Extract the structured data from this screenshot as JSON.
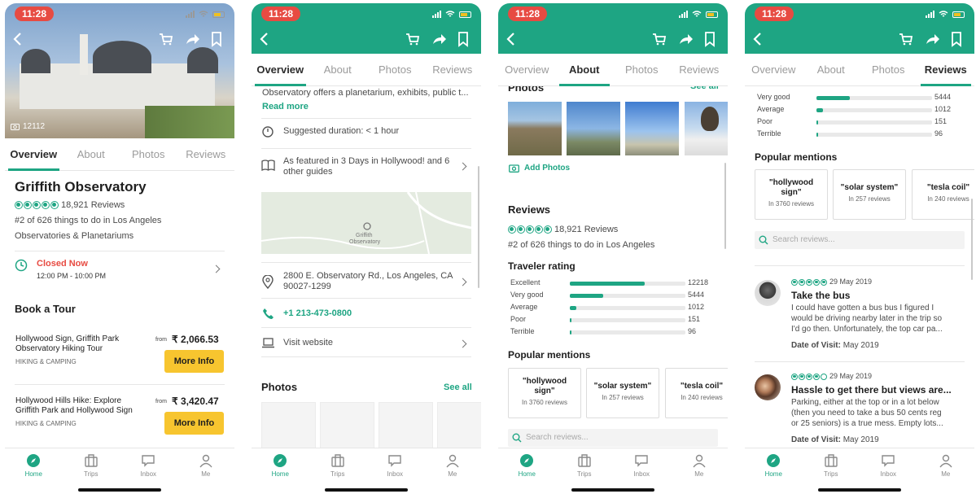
{
  "status": {
    "time": "11:28"
  },
  "tabs": [
    "Overview",
    "About",
    "Photos",
    "Reviews"
  ],
  "nav": [
    "Home",
    "Trips",
    "Inbox",
    "Me"
  ],
  "colors": {
    "accent": "#1ea583",
    "closed": "#e74b42",
    "button": "#f7c52f"
  },
  "s1": {
    "photo_count": "12112",
    "title": "Griffith Observatory",
    "reviews": "18,921 Reviews",
    "rank": "#2 of 626 things to do in Los Angeles",
    "category": "Observatories & Planetariums",
    "closed": "Closed Now",
    "hours": "12:00 PM - 10:00 PM",
    "book_title": "Book a Tour",
    "tours": [
      {
        "name1": "Hollywood Sign, Griffith Park",
        "name2": "Observatory Hiking Tour",
        "cat": "HIKING & CAMPING",
        "from": "from",
        "price": "₹ 2,066.53",
        "btn": "More Info"
      },
      {
        "name1": "Hollywood Hills Hike: Explore",
        "name2": "Griffith Park and Hollywood Sign",
        "cat": "HIKING & CAMPING",
        "from": "from",
        "price": "₹ 3,420.47",
        "btn": "More Info"
      }
    ]
  },
  "s2": {
    "desc": "Observatory offers a planetarium, exhibits, public t...",
    "read_more": "Read more",
    "duration": "Suggested duration: < 1 hour",
    "featured1": "As featured in 3 Days in Hollywood! and 6",
    "featured2": "other guides",
    "map_label1": "Griffith",
    "map_label2": "Observatory",
    "address1": "2800 E. Observatory Rd., Los Angeles, CA",
    "address2": "90027-1299",
    "phone": "+1 213-473-0800",
    "website": "Visit website",
    "photos_title": "Photos",
    "see_all": "See all"
  },
  "s3": {
    "photos_title": "Photos",
    "see_all": "See all",
    "add_photos": "Add Photos",
    "reviews_title": "Reviews",
    "reviews": "18,921 Reviews",
    "rank": "#2 of 626 things to do in Los Angeles",
    "traveler_rating": "Traveler rating",
    "ratings": [
      {
        "label": "Excellent",
        "count": "12218",
        "fraction": 0.65
      },
      {
        "label": "Very good",
        "count": "5444",
        "fraction": 0.29
      },
      {
        "label": "Average",
        "count": "1012",
        "fraction": 0.054
      },
      {
        "label": "Poor",
        "count": "151",
        "fraction": 0.012
      },
      {
        "label": "Terrible",
        "count": "96",
        "fraction": 0.008
      }
    ],
    "popular_mentions": "Popular mentions",
    "mentions": [
      {
        "q1": "\"hollywood",
        "q2": "sign\"",
        "n": "In 3760 reviews"
      },
      {
        "q1": "\"solar system\"",
        "q2": "",
        "n": "In 257 reviews"
      },
      {
        "q1": "\"tesla coil\"",
        "q2": "",
        "n": "In 240 reviews"
      }
    ],
    "search_placeholder": "Search reviews..."
  },
  "s4": {
    "ratings": [
      {
        "label": "Very good",
        "count": "5444",
        "fraction": 0.29
      },
      {
        "label": "Average",
        "count": "1012",
        "fraction": 0.054
      },
      {
        "label": "Poor",
        "count": "151",
        "fraction": 0.012
      },
      {
        "label": "Terrible",
        "count": "96",
        "fraction": 0.008
      }
    ],
    "popular_mentions": "Popular mentions",
    "mentions": [
      {
        "q1": "\"hollywood",
        "q2": "sign\"",
        "n": "In 3760 reviews"
      },
      {
        "q1": "\"solar system\"",
        "q2": "",
        "n": "In 257 reviews"
      },
      {
        "q1": "\"tesla coil\"",
        "q2": "",
        "n": "In 240 reviews"
      }
    ],
    "search_placeholder": "Search reviews...",
    "review1": {
      "date": "29 May 2019",
      "bubbles": 5,
      "title": "Take the bus",
      "l1": "I could have gotten a bus bus I figured I",
      "l2": "would be driving nearby later in the trip so",
      "l3": "I'd go then. Unfortunately, the top car pa...",
      "visit_label": "Date of Visit:",
      "visit": "May 2019"
    },
    "review2": {
      "date": "29 May 2019",
      "bubbles": 4,
      "title": "Hassle to get there but views are...",
      "l1": "Parking, either at the top or in a lot below",
      "l2": "(then you need to take a bus 50 cents reg",
      "l3": "or 25 seniors) is a true mess. Empty lots...",
      "visit_label": "Date of Visit:",
      "visit": "May 2019"
    }
  }
}
